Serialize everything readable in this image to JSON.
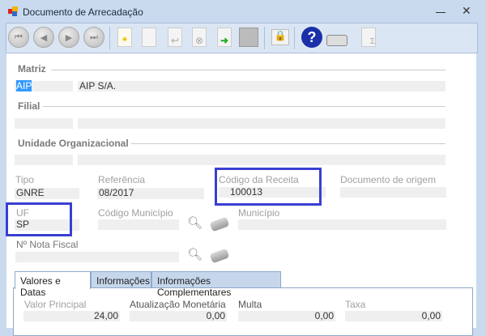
{
  "window": {
    "title": "Documento de Arrecadação"
  },
  "toolbar": {
    "buttons": [
      "first-icon",
      "previous-icon",
      "next-icon",
      "last-icon",
      "new-icon",
      "edit-icon",
      "undo-icon",
      "delete-icon",
      "export-icon",
      "save-icon",
      "lock-icon",
      "help-icon",
      "print-icon",
      "sum-report-icon"
    ]
  },
  "form": {
    "matriz": {
      "label": "Matriz",
      "code": "AIP",
      "name": "AIP S/A."
    },
    "filial": {
      "label": "Filial",
      "code": "",
      "name": ""
    },
    "unidade": {
      "label": "Unidade Organizacional",
      "code": "",
      "name": ""
    },
    "tipo": {
      "label": "Tipo",
      "value": "GNRE"
    },
    "referencia": {
      "label": "Referência",
      "value": "08/2017"
    },
    "codigo_receita": {
      "label": "Código da Receita",
      "value": "100013"
    },
    "documento_origem": {
      "label": "Documento de origem",
      "value": ""
    },
    "uf": {
      "label": "UF",
      "value": "SP"
    },
    "codigo_municipio": {
      "label": "Código Município",
      "value": ""
    },
    "municipio": {
      "label": "Município",
      "value": ""
    },
    "nota_fiscal": {
      "label": "Nº Nota Fiscal",
      "value": ""
    }
  },
  "tabs": [
    {
      "label": "Valores e Datas",
      "active": true
    },
    {
      "label": "Informações"
    },
    {
      "label": "Informações Complementares"
    }
  ],
  "valores": {
    "valor_principal": {
      "label": "Valor Principal",
      "value": "24,00"
    },
    "atualizacao": {
      "label": "Atualização Monetária",
      "value": "0,00"
    },
    "multa": {
      "label": "Multa",
      "value": "0,00"
    },
    "taxa": {
      "label": "Taxa",
      "value": "0,00"
    }
  }
}
